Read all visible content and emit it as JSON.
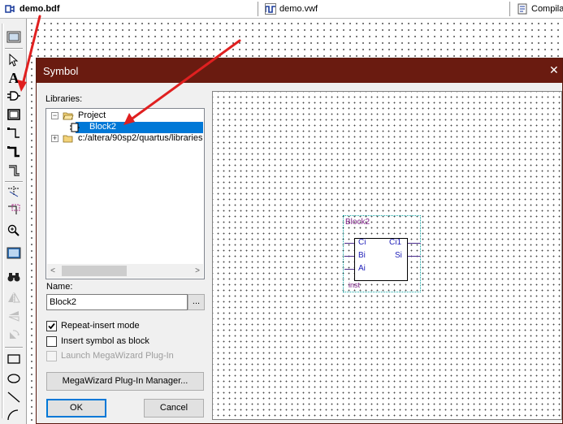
{
  "tabs": [
    {
      "label": "demo.bdf",
      "icon": "block-diagram-icon",
      "active": true
    },
    {
      "label": "demo.vwf",
      "icon": "waveform-icon",
      "active": false
    },
    {
      "label": "Compila",
      "icon": "compilation-report-icon",
      "active": false
    }
  ],
  "toolbar": {
    "tools": [
      {
        "name": "selection-tool",
        "icon": "arrow-pointer-icon"
      },
      {
        "name": "text-tool",
        "icon": "text-tool-icon",
        "glyph": "A"
      },
      {
        "name": "symbol-tool",
        "icon": "symbol-tool-icon"
      },
      {
        "name": "block-tool",
        "icon": "block-tool-icon"
      },
      {
        "name": "orthogonal-node-tool",
        "icon": "node-tool-icon"
      },
      {
        "name": "orthogonal-bus-tool",
        "icon": "bus-tool-icon"
      },
      {
        "name": "orthogonal-conduit-tool",
        "icon": "conduit-tool-icon"
      },
      {
        "name": "rubberbanding-tool",
        "icon": "rubberband-icon"
      },
      {
        "name": "partial-line-selection-tool",
        "icon": "partial-line-icon"
      },
      {
        "name": "zoom-tool",
        "icon": "zoom-icon"
      },
      {
        "name": "full-screen-tool",
        "icon": "full-screen-icon"
      },
      {
        "name": "find-tool",
        "icon": "binoculars-icon"
      },
      {
        "name": "flip-horizontal-tool",
        "icon": "flip-horizontal-icon"
      },
      {
        "name": "flip-vertical-tool",
        "icon": "flip-vertical-icon"
      },
      {
        "name": "rotate-tool",
        "icon": "rotate-icon"
      },
      {
        "name": "rectangle-tool",
        "icon": "rectangle-icon"
      },
      {
        "name": "oval-tool",
        "icon": "oval-icon"
      },
      {
        "name": "line-tool",
        "icon": "line-icon"
      }
    ]
  },
  "dialog": {
    "title": "Symbol",
    "close_glyph": "✕",
    "libraries_label": "Libraries:",
    "tree": {
      "project": {
        "label": "Project",
        "expander": "−"
      },
      "block2": {
        "label": "Block2"
      },
      "library": {
        "label": "c:/altera/90sp2/quartus/libraries",
        "expander": "+"
      }
    },
    "scroll_left": "<",
    "scroll_right": ">",
    "name_label": "Name:",
    "name_value": "Block2",
    "browse_label": "...",
    "repeat_insert": {
      "label": "Repeat-insert mode",
      "checked": true
    },
    "insert_as_block": {
      "label": "Insert symbol as block",
      "checked": false
    },
    "launch_megawizard": {
      "label": "Launch MegaWizard Plug-In",
      "checked": false,
      "disabled": true
    },
    "megawizard_button": "MegaWizard Plug-In Manager...",
    "ok_button": "OK",
    "cancel_button": "Cancel"
  },
  "symbol": {
    "name": "Block2",
    "instance": "inst",
    "inputs": [
      "Ci",
      "Bi",
      "Ai"
    ],
    "outputs": [
      "Ci1",
      "Si"
    ]
  },
  "colors": {
    "title_bar": "#6a1b10",
    "selection": "#0078d7",
    "annotation_arrow": "#e02020",
    "symbol_label": "#7b1d86",
    "pin_label": "#1d1db8"
  }
}
